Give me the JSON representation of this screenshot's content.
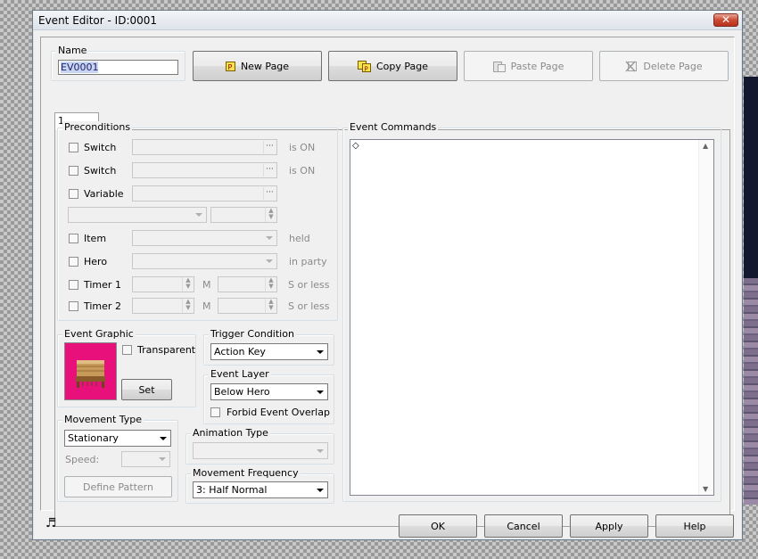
{
  "window": {
    "title": "Event Editor - ID:0001",
    "close_glyph": "✕"
  },
  "name_group": {
    "label": "Name",
    "value": "EV0001"
  },
  "page_buttons": {
    "new_page": "New Page",
    "copy_page": "Copy Page",
    "paste_page": "Paste Page",
    "delete_page": "Delete Page"
  },
  "tab": {
    "label": "1"
  },
  "preconditions": {
    "label": "Preconditions",
    "switch1": {
      "label": "Switch",
      "suffix": "is ON"
    },
    "switch2": {
      "label": "Switch",
      "suffix": "is ON"
    },
    "variable": {
      "label": "Variable"
    },
    "item": {
      "label": "Item",
      "suffix": "held"
    },
    "hero": {
      "label": "Hero",
      "suffix": "in party"
    },
    "timer1": {
      "label": "Timer 1",
      "m": "M",
      "suffix": "S or less"
    },
    "timer2": {
      "label": "Timer 2",
      "m": "M",
      "suffix": "S or less"
    }
  },
  "event_graphic": {
    "label": "Event Graphic",
    "transparent": "Transparent",
    "set": "Set",
    "bg_color": "#e8107a"
  },
  "trigger": {
    "label": "Trigger Condition",
    "value": "Action Key"
  },
  "event_layer": {
    "label": "Event Layer",
    "value": "Below Hero",
    "forbid_overlap": "Forbid Event Overlap"
  },
  "movement_type": {
    "label": "Movement Type",
    "value": "Stationary",
    "speed_label": "Speed:",
    "define_pattern": "Define Pattern"
  },
  "animation_type": {
    "label": "Animation Type"
  },
  "movement_frequency": {
    "label": "Movement Frequency",
    "value": "3: Half Normal"
  },
  "event_commands": {
    "label": "Event Commands",
    "first_line": "◇"
  },
  "footer": {
    "ok": "OK",
    "cancel": "Cancel",
    "apply": "Apply",
    "help": "Help",
    "music_icon_glyph": "♬"
  }
}
